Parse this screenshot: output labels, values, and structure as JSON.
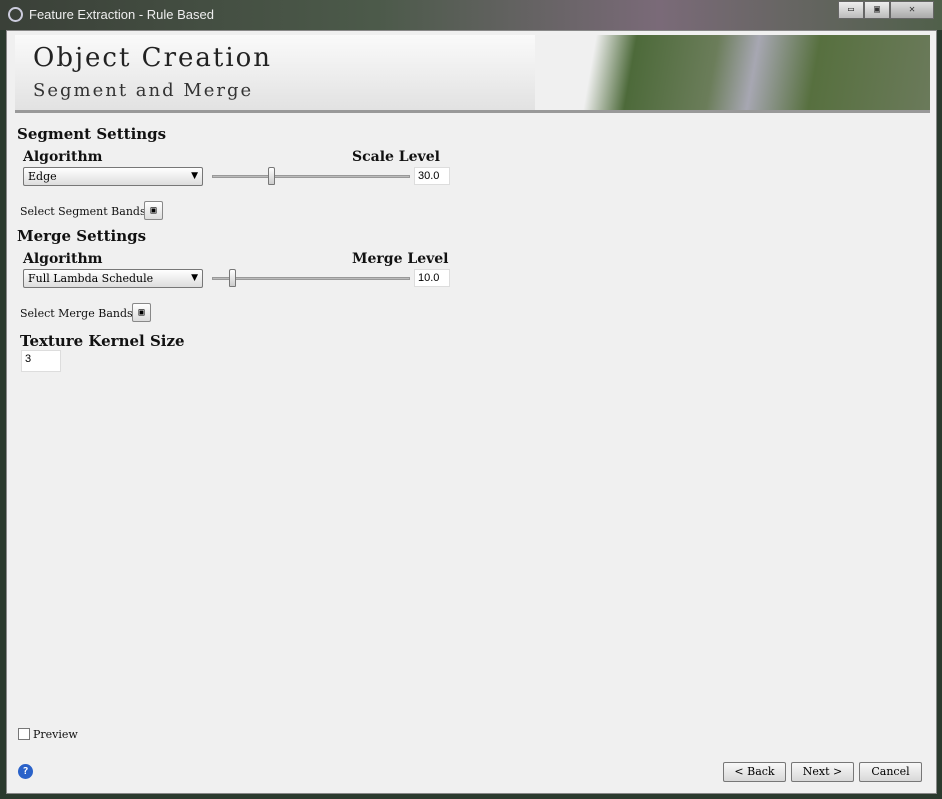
{
  "window": {
    "title": "Feature Extraction - Rule Based",
    "minimize": "▭",
    "maximize": "▣",
    "close": "✕"
  },
  "header": {
    "title": "Object Creation",
    "subtitle": "Segment and Merge"
  },
  "segment": {
    "heading": "Segment Settings",
    "algorithm_label": "Algorithm",
    "algorithm_value": "Edge",
    "level_label": "Scale Level",
    "level_value": "30.0",
    "slider_fraction": 0.3,
    "bands_label": "Select Segment Bands"
  },
  "merge": {
    "heading": "Merge Settings",
    "algorithm_label": "Algorithm",
    "algorithm_value": "Full Lambda Schedule",
    "level_label": "Merge Level",
    "level_value": "10.0",
    "slider_fraction": 0.1,
    "bands_label": "Select Merge Bands"
  },
  "texture": {
    "label": "Texture Kernel Size",
    "value": "3"
  },
  "preview_label": "Preview",
  "buttons": {
    "back": "< Back",
    "next": "Next >",
    "cancel": "Cancel"
  },
  "help": "?"
}
